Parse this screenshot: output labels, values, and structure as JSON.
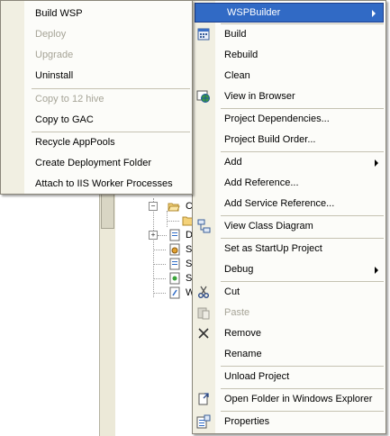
{
  "submenu": {
    "items": [
      {
        "label": "Build WSP",
        "enabled": true
      },
      {
        "label": "Deploy",
        "enabled": false
      },
      {
        "label": "Upgrade",
        "enabled": false
      },
      {
        "label": "Uninstall",
        "enabled": true
      },
      {
        "label": "Copy to 12 hive",
        "enabled": false
      },
      {
        "label": "Copy to GAC",
        "enabled": true
      },
      {
        "label": "Recycle AppPools",
        "enabled": true
      },
      {
        "label": "Create Deployment Folder",
        "enabled": true
      },
      {
        "label": "Attach to IIS Worker Processes",
        "enabled": true
      }
    ]
  },
  "context_menu": {
    "header": {
      "label": "WSPBuilder",
      "highlight_color": "#316ac5"
    },
    "items": [
      {
        "label": "Build",
        "icon": "build-icon",
        "enabled": true
      },
      {
        "label": "Rebuild",
        "enabled": true
      },
      {
        "label": "Clean",
        "enabled": true
      },
      {
        "label": "View in Browser",
        "icon": "browser-icon",
        "enabled": true
      },
      {
        "label": "Project Dependencies...",
        "enabled": true
      },
      {
        "label": "Project Build Order...",
        "enabled": true
      },
      {
        "label": "Add",
        "enabled": true,
        "submenu": true
      },
      {
        "label": "Add Reference...",
        "enabled": true
      },
      {
        "label": "Add Service Reference...",
        "enabled": true
      },
      {
        "label": "View Class Diagram",
        "icon": "class-diagram-icon",
        "enabled": true
      },
      {
        "label": "Set as StartUp Project",
        "enabled": true
      },
      {
        "label": "Debug",
        "enabled": true,
        "submenu": true
      },
      {
        "label": "Cut",
        "icon": "scissors-icon",
        "enabled": true
      },
      {
        "label": "Paste",
        "icon": "paste-icon",
        "enabled": false
      },
      {
        "label": "Remove",
        "icon": "remove-x-icon",
        "enabled": true
      },
      {
        "label": "Rename",
        "enabled": true
      },
      {
        "label": "Unload Project",
        "enabled": true
      },
      {
        "label": "Open Folder in Windows Explorer",
        "icon": "open-folder-icon",
        "enabled": true
      },
      {
        "label": "Properties",
        "icon": "properties-icon",
        "enabled": true
      }
    ]
  },
  "tree": {
    "letters": [
      "C",
      "D",
      "S",
      "S",
      "S",
      "W"
    ]
  },
  "colors": {
    "menu_bg": "#fcfcf9",
    "gutter": "#f1efe2",
    "disabled_text": "#a6a497",
    "selection": "#316ac5"
  }
}
